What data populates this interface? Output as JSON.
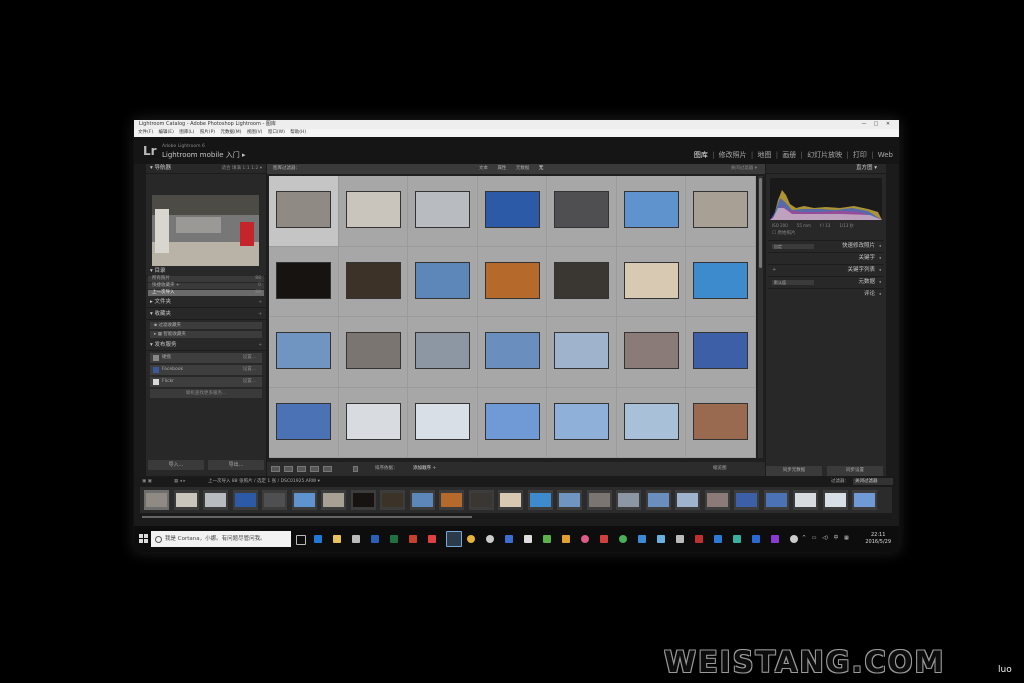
{
  "window": {
    "title": "Lightroom Catalog - Adobe Photoshop Lightroom - 图库",
    "controls": [
      "—",
      "□",
      "✕"
    ]
  },
  "menubar": [
    "文件(F)",
    "编辑(E)",
    "图库(L)",
    "照片(P)",
    "元数据(M)",
    "视图(V)",
    "窗口(W)",
    "帮助(H)"
  ],
  "identity": {
    "logo": "Lr",
    "product": "Adobe Lightroom 6",
    "mobile_label": "Lightroom mobile 入门 ▸",
    "modules": [
      "图库",
      "修改照片",
      "地图",
      "画册",
      "幻灯片放映",
      "打印",
      "Web"
    ],
    "active_module": "图库"
  },
  "left_panel": {
    "navigator": {
      "title": "导航器",
      "zoom": "适合  填满  1:1  1:2 ▾"
    },
    "catalog": {
      "title": "目录",
      "items": [
        {
          "label": "所有照片",
          "count": "88"
        },
        {
          "label": "快捷收藏夹 +",
          "count": "0"
        },
        {
          "label": "上一次导入",
          "count": "88"
        }
      ]
    },
    "folders": {
      "title": "文件夹"
    },
    "collections": {
      "title": "收藏夹",
      "items": [
        "▪ 过滤收藏夹",
        "▸ ▦ 智能收藏夹"
      ]
    },
    "publish": {
      "title": "发布服务",
      "items": [
        {
          "label": "硬盘",
          "action": "设置..."
        },
        {
          "label": "Facebook",
          "action": "设置..."
        },
        {
          "label": "Flickr",
          "action": "设置..."
        }
      ],
      "find_more": "联机查找更多服务..."
    },
    "import_button": "导入...",
    "export_button": "导出..."
  },
  "filter_bar": {
    "label": "图库过滤器：",
    "options": [
      "文本",
      "属性",
      "元数据",
      "无"
    ],
    "active": "无",
    "preset": "关闭过滤器 ▾"
  },
  "grid": {
    "rows": [
      [
        "#8f8b84",
        "#c9c5bd",
        "#b8bcc0",
        "#2c5aa6",
        "#4f4f52",
        "#5e93ce",
        "#a89f95"
      ],
      [
        "#161310",
        "#3d3228",
        "#5d86b9",
        "#b56a2b",
        "#3a3632",
        "#d8c9b2",
        "#3d8bcc"
      ],
      [
        "#6f95c0",
        "#7a7570",
        "#8c97a3",
        "#6a8fbe",
        "#9fb3cc",
        "#8a7a78",
        "#3d5fa7"
      ],
      [
        "#4b72b5",
        "#d8dbe0",
        "#d9dfe6",
        "#6f9ad5",
        "#8fb0d8",
        "#a8c0d8",
        "#9a6a50"
      ]
    ],
    "selected_cell": "0-0"
  },
  "toolbar": {
    "sort_label": "排序依据：",
    "sort_value": "添加顺序 ÷",
    "thumbs_label": "缩览图"
  },
  "right_panel": {
    "histogram": {
      "title": "直方图",
      "exif": [
        "ISO 200",
        "55 mm",
        "f / 13",
        "1/13 秒"
      ],
      "original_label": "原始照片"
    },
    "sections": [
      {
        "label": "快速修改照片",
        "control": "自定"
      },
      {
        "label": "关键字",
        "control": ""
      },
      {
        "label": "关键字列表",
        "control": ""
      },
      {
        "label": "元数据",
        "control": "默认值"
      },
      {
        "label": "评论",
        "control": ""
      }
    ],
    "sync_metadata": "同步元数据",
    "sync_settings": "同步设置"
  },
  "filmstrip": {
    "source": "上一次导入  88 张照片 / 选定 1 张 / DSC01925.ARW ▾",
    "filter_label": "过滤器：",
    "filter_value": "关闭过滤器",
    "thumbs": [
      "#8f8b84",
      "#c9c5bd",
      "#b8bcc0",
      "#2c5aa6",
      "#4f4f52",
      "#5e93ce",
      "#a89f95",
      "#161310",
      "#3d3228",
      "#5d86b9",
      "#b56a2b",
      "#3a3632",
      "#d8c9b2",
      "#3d8bcc",
      "#6f95c0",
      "#7a7570",
      "#8c97a3",
      "#6a8fbe",
      "#9fb3cc",
      "#8a7a78",
      "#3d5fa7",
      "#4b72b5",
      "#d8dbe0",
      "#d9dfe6",
      "#6f9ad5"
    ]
  },
  "taskbar": {
    "search_placeholder": "我是 Cortana，小娜。有问题尽管问我。",
    "tray": [
      "^",
      "▭",
      "◁)",
      "中",
      "▦"
    ],
    "time": "22:11",
    "date": "2016/5/29"
  },
  "overlay": {
    "watermark": "WEISTANG.COM",
    "credit": "luo"
  }
}
